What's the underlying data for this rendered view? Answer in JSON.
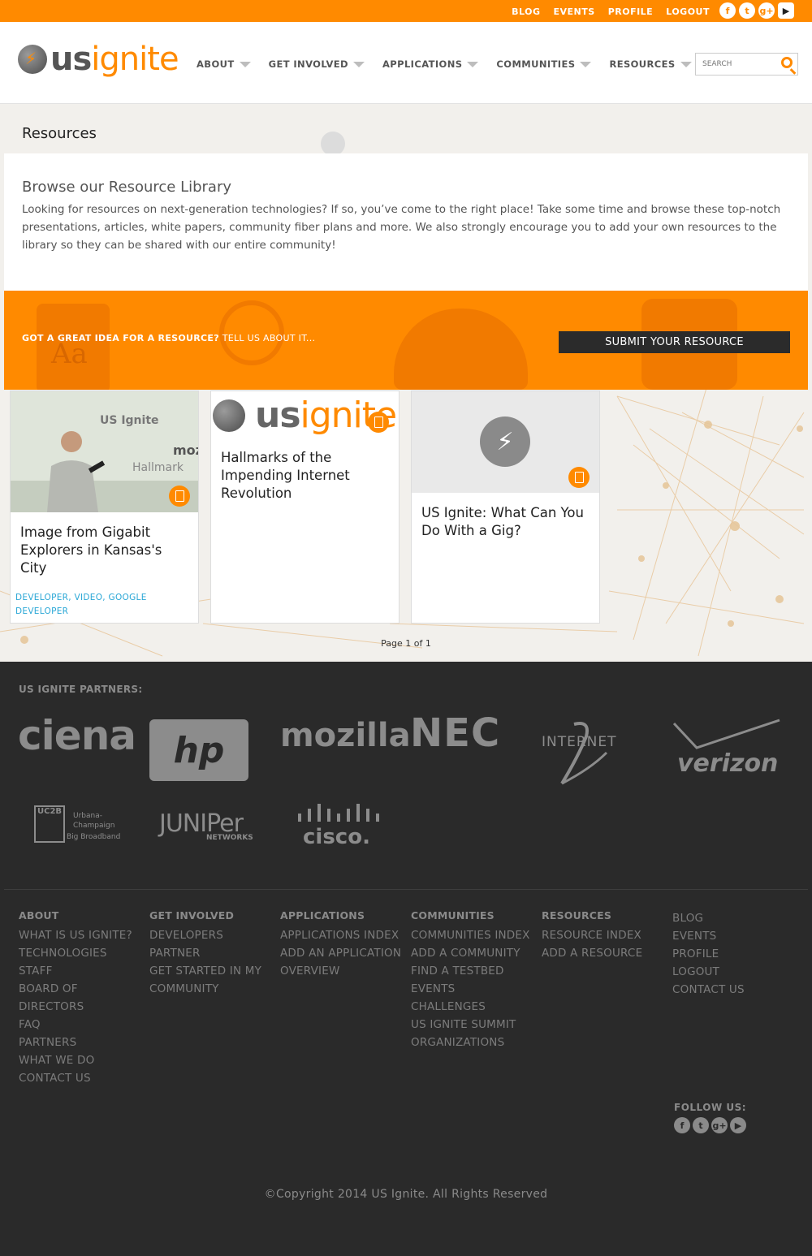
{
  "topbar": {
    "links": [
      "BLOG",
      "EVENTS",
      "PROFILE",
      "LOGOUT"
    ],
    "social": [
      "facebook-icon",
      "twitter-icon",
      "google-plus-icon",
      "youtube-icon"
    ]
  },
  "header": {
    "logo_us": "us",
    "logo_ignite": "ignite",
    "nav": [
      "ABOUT",
      "GET INVOLVED",
      "APPLICATIONS",
      "COMMUNITIES",
      "RESOURCES"
    ],
    "search_placeholder": "SEARCH"
  },
  "page": {
    "title": "Resources",
    "intro_heading": "Browse our Resource Library",
    "intro_text": "Looking for resources on next-generation technologies? If so, you’ve come to the right place! Take some time and browse these top-notch presentations, articles, white papers, community fiber plans and more. We also strongly encourage you to add your own resources to the library so they can be shared with our entire community!"
  },
  "cta": {
    "bold": "GOT A GREAT IDEA FOR A RESOURCE?",
    "rest": "TELL US ABOUT IT...",
    "button": "SUBMIT YOUR RESOURCE",
    "deco_text": "Aa"
  },
  "cards": [
    {
      "title": "Image from Gigabit Explorers in Kansas's City",
      "tags": "DEVELOPER, VIDEO, GOOGLE DEVELOPER"
    },
    {
      "title": "Hallmarks of the Impending Internet Revolution",
      "tags": ""
    },
    {
      "title": "US Ignite: What Can You Do With a Gig?",
      "tags": ""
    }
  ],
  "pager": "Page 1 of 1",
  "footer": {
    "partners_heading": "US IGNITE PARTNERS:",
    "partners": [
      "ciena",
      "hp",
      "mozilla",
      "NEC",
      "INTERNET",
      "verizon",
      "UC2B",
      "JUNIPer",
      "NETWORKS",
      "cisco."
    ],
    "uc2b_lines": [
      "Urbana-",
      "Champaign",
      "Big Broadband"
    ],
    "columns": [
      {
        "heading": "ABOUT",
        "links": [
          "WHAT IS US IGNITE?",
          "TECHNOLOGIES",
          "STAFF",
          "BOARD OF DIRECTORS",
          "FAQ",
          "PARTNERS",
          "WHAT WE DO",
          "CONTACT US"
        ]
      },
      {
        "heading": "GET INVOLVED",
        "links": [
          "DEVELOPERS",
          "PARTNER",
          "GET STARTED IN MY COMMUNITY"
        ]
      },
      {
        "heading": "APPLICATIONS",
        "links": [
          "APPLICATIONS INDEX",
          "ADD AN APPLICATION",
          "OVERVIEW"
        ]
      },
      {
        "heading": "COMMUNITIES",
        "links": [
          "COMMUNITIES INDEX",
          "ADD A COMMUNITY",
          "FIND A TESTBED",
          "EVENTS",
          "CHALLENGES",
          "US IGNITE SUMMIT",
          "ORGANIZATIONS"
        ]
      },
      {
        "heading": "RESOURCES",
        "links": [
          "RESOURCE INDEX",
          "ADD A RESOURCE"
        ]
      },
      {
        "heading": "",
        "links": [
          "BLOG",
          "EVENTS",
          "PROFILE",
          "LOGOUT",
          "CONTACT US"
        ]
      }
    ],
    "follow": "FOLLOW US:",
    "copyright": "©Copyright 2014 US Ignite. All Rights Reserved"
  },
  "colors": {
    "accent": "#ff8a00",
    "dark": "#2a2a2a",
    "link": "#2aa7d6"
  }
}
